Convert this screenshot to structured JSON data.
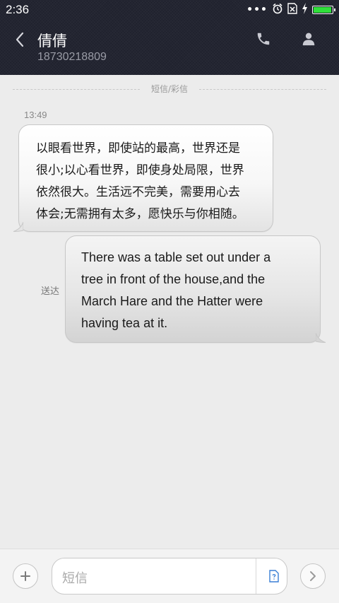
{
  "status_bar": {
    "time": "2:36",
    "battery_level": 0.95,
    "battery_color": "#2fe03a",
    "icons": [
      "more-dots-icon",
      "alarm-icon",
      "sim-error-icon",
      "charging-icon",
      "battery-icon"
    ]
  },
  "header": {
    "contact_name": "倩倩",
    "phone_number": "18730218809",
    "background_color": "#20222e"
  },
  "conversation": {
    "divider_label": "短信/彩信",
    "messages": [
      {
        "direction": "incoming",
        "time": "13:49",
        "lines": [
          "以眼看世界，即使站的最高，世界还是",
          "很小;以心看世界，即使身处局限，世界",
          "依然很大。生活远不完美，需要用心去",
          "体会;无需拥有太多，愿快乐与你相随。"
        ]
      },
      {
        "direction": "outgoing",
        "status": "送达",
        "lines": [
          "There was a table set out under a",
          "tree in front of the house,and the",
          "March Hare and the Hatter were",
          "having tea at it."
        ]
      }
    ]
  },
  "input_bar": {
    "placeholder": "短信",
    "icons": [
      "plus-icon",
      "sim-card-icon",
      "send-arrow-icon"
    ]
  }
}
